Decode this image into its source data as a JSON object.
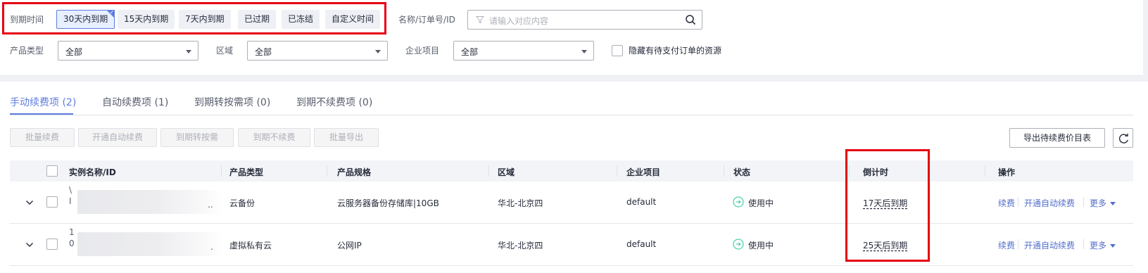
{
  "filters": {
    "expiry_label": "到期时间",
    "expiry_options": [
      "30天内到期",
      "15天内到期",
      "7天内到期",
      "已过期",
      "已冻结",
      "自定义时间"
    ],
    "search_label": "名称/订单号/ID",
    "search_placeholder": "请输入对应内容",
    "product_type_label": "产品类型",
    "product_type_value": "全部",
    "region_label": "区域",
    "region_value": "全部",
    "project_label": "企业项目",
    "project_value": "全部",
    "hide_pending_label": "隐藏有待支付订单的资源"
  },
  "tabs": [
    {
      "label": "手动续费项 (2)"
    },
    {
      "label": "自动续费项 (1)"
    },
    {
      "label": "到期转按需项 (0)"
    },
    {
      "label": "到期不续费项 (0)"
    }
  ],
  "toolbar": {
    "batch_renew": "批量续费",
    "enable_auto_renew": "开通自动续费",
    "to_on_demand": "到期转按需",
    "no_renew": "到期不续费",
    "batch_export": "批量导出",
    "export_price_list": "导出待续费价目表"
  },
  "table": {
    "columns": [
      "实例名称/ID",
      "产品类型",
      "产品规格",
      "区域",
      "企业项目",
      "状态",
      "倒计时",
      "操作"
    ],
    "rows": [
      {
        "name_prefix": "\\",
        "id_prefix": "I",
        "id_suffix": "..",
        "product_type": "云备份",
        "spec": "云服务器备份存储库|10GB",
        "region": "华北-北京四",
        "project": "default",
        "status": "使用中",
        "countdown": "17天后到期"
      },
      {
        "name_prefix": "1",
        "id_prefix": "0",
        "id_suffix": ".",
        "product_type": "虚拟私有云",
        "spec": "公网IP",
        "region": "华北-北京四",
        "project": "default",
        "status": "使用中",
        "countdown": "25天后到期"
      }
    ],
    "actions": {
      "renew": "续费",
      "auto_renew": "开通自动续费",
      "more": "更多"
    }
  },
  "colors": {
    "accent": "#5e7ce0",
    "link": "#526ecc",
    "highlight": "#e60012",
    "status_ok": "#50d4ab"
  }
}
